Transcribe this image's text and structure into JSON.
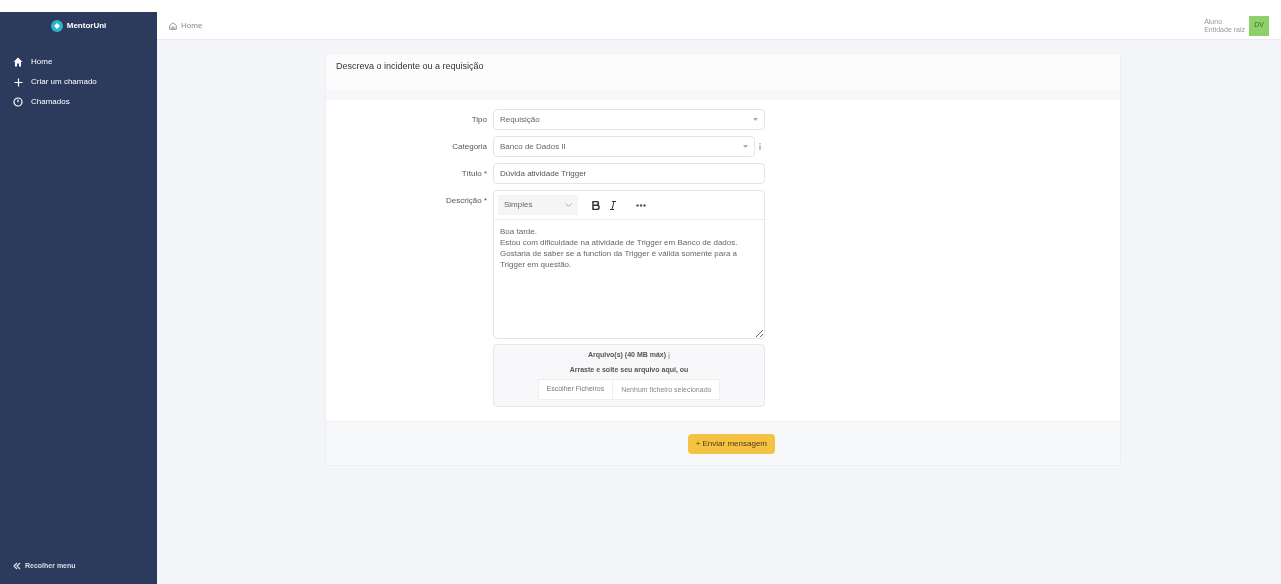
{
  "sidebar": {
    "brand": "MentorUni",
    "items": [
      {
        "label": "Home",
        "selected": false
      },
      {
        "label": "Criar um chamado",
        "selected": false
      },
      {
        "label": "Chamados",
        "selected": false
      }
    ],
    "collapse": "Recolher menu"
  },
  "header": {
    "breadcrumb": "Home",
    "user_role": "Aluno",
    "user_entity": "Entidade raiz",
    "avatar": "DV"
  },
  "form": {
    "title": "Descreva o incidente ou a requisição",
    "fields": [
      {
        "kind": "select",
        "label": "Tipo",
        "value": "Requisição"
      },
      {
        "kind": "select",
        "label": "Categoria",
        "value": "Banco de Dados II",
        "info": true
      },
      {
        "kind": "text",
        "label": "Título *",
        "value": "Dúvida atividade Trigger"
      },
      {
        "kind": "editor",
        "label": "Descrição *",
        "format": "Simples",
        "value": "Boa tarde.\nEstou com dificuldade na atividade de Trigger em Banco de dados. Gostaria de saber se a function da Trigger é válida somente para a Trigger em questão."
      }
    ],
    "upload": {
      "title": "Arquivo(s) (40 MB máx)",
      "hint": "Arraste e solte seu arquivo aqui, ou",
      "button": "Escolher Ficheiros",
      "status": "Nenhum ficheiro selecionado"
    },
    "submit": "+ Enviar mensagem"
  }
}
